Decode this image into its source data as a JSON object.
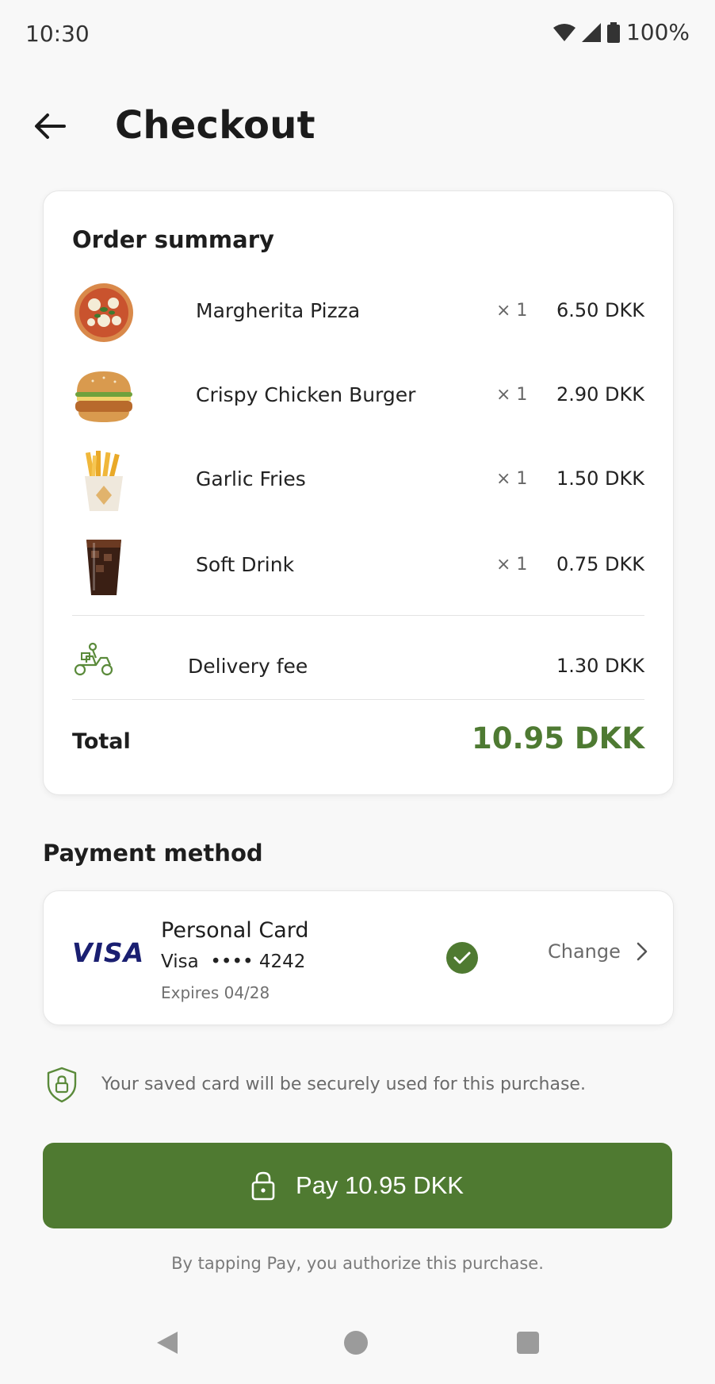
{
  "status_bar": {
    "time": "10:30",
    "battery": "100%"
  },
  "header": {
    "title": "Checkout"
  },
  "order_summary": {
    "title": "Order summary",
    "items": [
      {
        "name": "Margherita Pizza",
        "qty": "× 1",
        "price": "6.50 DKK",
        "icon": "pizza-icon"
      },
      {
        "name": "Crispy Chicken Burger",
        "qty": "× 1",
        "price": "2.90 DKK",
        "icon": "burger-icon"
      },
      {
        "name": "Garlic Fries",
        "qty": "× 1",
        "price": "1.50 DKK",
        "icon": "fries-icon"
      },
      {
        "name": "Soft Drink",
        "qty": "× 1",
        "price": "0.75 DKK",
        "icon": "drink-icon"
      }
    ],
    "delivery": {
      "label": "Delivery fee",
      "price": "1.30 DKK",
      "icon": "scooter-icon"
    },
    "total": {
      "label": "Total",
      "value": "10.95 DKK"
    }
  },
  "payment": {
    "heading": "Payment method",
    "card": {
      "brand": "VISA",
      "name": "Personal Card",
      "number": "Visa  •••• 4242",
      "expiry": "Expires 04/28",
      "change_label": "Change"
    }
  },
  "security_note": "Your saved card will be securely used for this purchase.",
  "pay_button": {
    "label": "Pay 10.95 DKK"
  },
  "authorize_note": "By tapping Pay, you authorize this purchase.",
  "colors": {
    "accent": "#4f7a31",
    "total": "#4e7a32",
    "visa": "#1a1f71"
  }
}
